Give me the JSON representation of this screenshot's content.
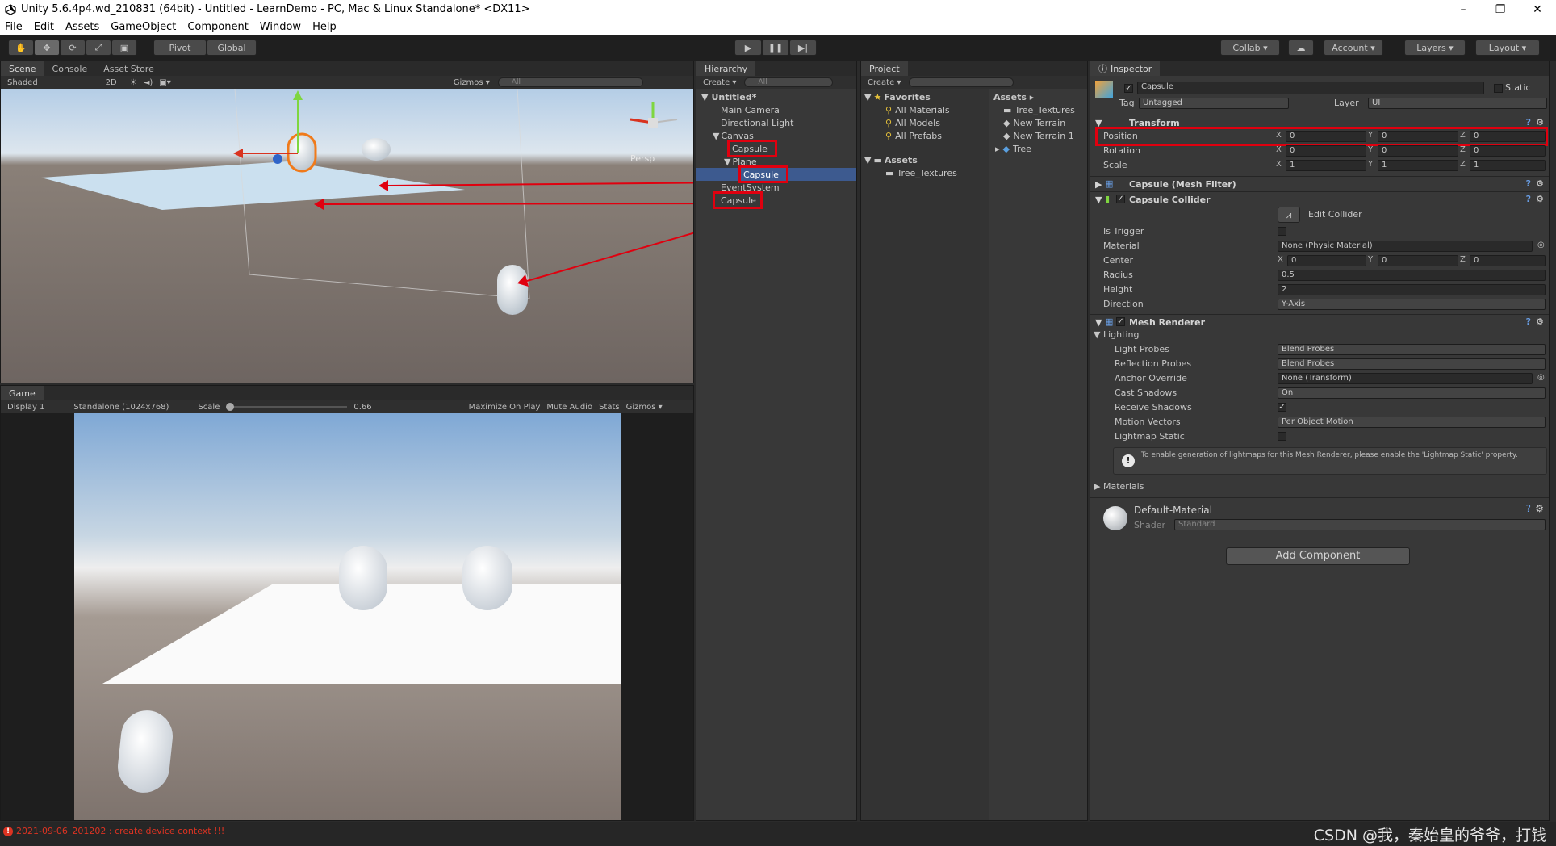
{
  "window": {
    "title": "Unity 5.6.4p4.wd_210831 (64bit) - Untitled - LearnDemo - PC, Mac & Linux Standalone* <DX11>",
    "minimize": "–",
    "maximize": "❐",
    "close": "✕"
  },
  "menu": [
    "File",
    "Edit",
    "Assets",
    "GameObject",
    "Component",
    "Window",
    "Help"
  ],
  "toolbar": {
    "pivot": "Pivot",
    "global": "Global",
    "collab": "Collab ▾",
    "account": "Account ▾",
    "layers": "Layers ▾",
    "layout": "Layout ▾"
  },
  "scene": {
    "tabs": [
      "Scene",
      "Console",
      "Asset Store"
    ],
    "shaded": "Shaded",
    "mode2d": "2D",
    "gizmos": "Gizmos ▾",
    "search_placeholder": "All",
    "persp": "Persp"
  },
  "game": {
    "tab": "Game",
    "display": "Display 1",
    "resolution": "Standalone (1024x768)",
    "scale_label": "Scale",
    "scale_value": "0.66",
    "maximize": "Maximize On Play",
    "mute": "Mute Audio",
    "stats": "Stats",
    "gizmos": "Gizmos ▾"
  },
  "hierarchy": {
    "tab": "Hierarchy",
    "create": "Create ▾",
    "search_placeholder": "All",
    "scene_name": "Untitled*",
    "items": [
      {
        "label": "Main Camera",
        "indent": 1
      },
      {
        "label": "Directional Light",
        "indent": 1
      },
      {
        "label": "Canvas",
        "indent": 1
      },
      {
        "label": "Capsule",
        "indent": 2
      },
      {
        "label": "Plane",
        "indent": 2
      },
      {
        "label": "Capsule",
        "indent": 3
      },
      {
        "label": "EventSystem",
        "indent": 1
      },
      {
        "label": "Capsule",
        "indent": 1
      }
    ]
  },
  "project": {
    "tab": "Project",
    "create": "Create ▾",
    "favorites_title": "Favorites",
    "favorites": [
      "All Materials",
      "All Models",
      "All Prefabs"
    ],
    "assets_title": "Assets",
    "assets_tree": [
      "Tree_Textures"
    ],
    "breadcrumb": "Assets ▸",
    "asset_items": [
      "Tree_Textures",
      "New Terrain",
      "New Terrain 1",
      "Tree"
    ]
  },
  "inspector": {
    "tab": "Inspector",
    "object_name": "Capsule",
    "static": "Static",
    "tag_label": "Tag",
    "tag_value": "Untagged",
    "layer_label": "Layer",
    "layer_value": "UI",
    "transform": {
      "title": "Transform",
      "position": {
        "label": "Position",
        "x": "0",
        "y": "0",
        "z": "0"
      },
      "rotation": {
        "label": "Rotation",
        "x": "0",
        "y": "0",
        "z": "0"
      },
      "scale": {
        "label": "Scale",
        "x": "1",
        "y": "1",
        "z": "1"
      }
    },
    "mesh_filter": "Capsule (Mesh Filter)",
    "collider": {
      "title": "Capsule Collider",
      "edit": "Edit Collider",
      "is_trigger": "Is Trigger",
      "material": "Material",
      "material_value": "None (Physic Material)",
      "center": "Center",
      "cx": "0",
      "cy": "0",
      "cz": "0",
      "radius": "Radius",
      "radius_value": "0.5",
      "height": "Height",
      "height_value": "2",
      "direction": "Direction",
      "direction_value": "Y-Axis"
    },
    "renderer": {
      "title": "Mesh Renderer",
      "lighting": "Lighting",
      "light_probes": "Light Probes",
      "light_probes_value": "Blend Probes",
      "reflection_probes": "Reflection Probes",
      "reflection_probes_value": "Blend Probes",
      "anchor_override": "Anchor Override",
      "anchor_override_value": "None (Transform)",
      "cast_shadows": "Cast Shadows",
      "cast_shadows_value": "On",
      "receive_shadows": "Receive Shadows",
      "motion_vectors": "Motion Vectors",
      "motion_vectors_value": "Per Object Motion",
      "lightmap_static": "Lightmap Static",
      "info": "To enable generation of lightmaps for this Mesh Renderer, please enable the 'Lightmap Static' property.",
      "materials": "Materials"
    },
    "material": {
      "name": "Default-Material",
      "shader_label": "Shader",
      "shader_value": "Standard"
    },
    "add_component": "Add Component"
  },
  "status": {
    "error": "2021-09-06_201202 : create device context !!!"
  },
  "watermark": "CSDN @我，秦始皇的爷爷，打钱"
}
